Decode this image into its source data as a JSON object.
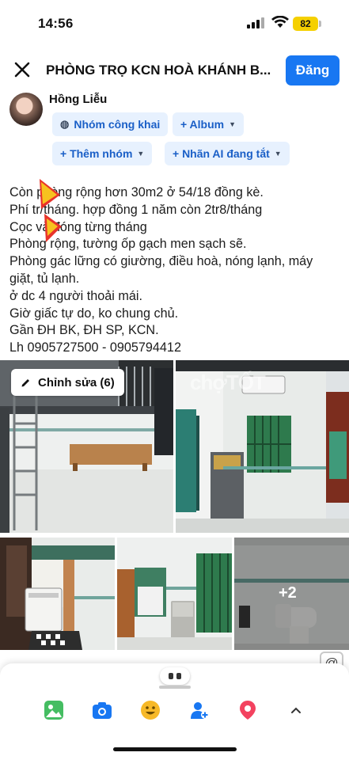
{
  "status_bar": {
    "time": "14:56",
    "battery": "82"
  },
  "header": {
    "title": "PHÒNG TRỌ KCN HOÀ KHÁNH B...",
    "post_label": "Đăng"
  },
  "author": {
    "name": "Hồng Liễu"
  },
  "chips": {
    "public_group": "Nhóm công khai",
    "album": "+ Album",
    "add_group": "+ Thêm nhóm",
    "ai_label": "+ Nhãn AI đang tắt"
  },
  "post_lines": [
    "Còn phòng rộng hơn 30m2 ở 54/18 đồng kè.",
    "Phí   tr/tháng. hợp đồng 1 năm còn 2tr8/tháng",
    "Cọc     và đóng từng tháng",
    "Phòng rộng, tường ốp gạch men sạch sẽ.",
    "Phòng gác lững có giường, điều hoà, nóng lạnh, máy",
    "giặt, tủ lạnh.",
    " ở dc 4 người thoải mái.",
    "Giờ giấc tự do, ko chung chủ.",
    "Gần ĐH BK, ĐH SP, KCN.",
    "Lh 0905727500 - 0905794412"
  ],
  "photos": {
    "edit_label": "Chỉnh sửa (6)",
    "more_label": "+2",
    "watermark": "chợTỐT"
  },
  "icons": {
    "close": "close-icon",
    "photo": "photo-icon",
    "camera": "camera-icon",
    "emoji": "emoji-icon",
    "tag": "tag-people-icon",
    "location": "location-icon",
    "expand": "chevron-up-icon"
  },
  "colors": {
    "accent": "#1877f2",
    "chip_bg": "#e7f1fe",
    "chip_text": "#1a5fc7"
  }
}
